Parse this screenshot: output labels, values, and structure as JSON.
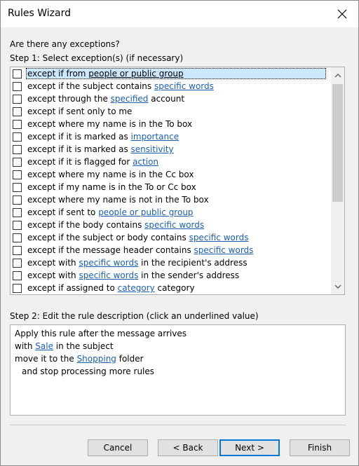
{
  "window": {
    "title": "Rules Wizard"
  },
  "question": "Are there any exceptions?",
  "step1_label": "Step 1: Select exception(s) (if necessary)",
  "exceptions": [
    {
      "parts": [
        {
          "t": "except if from "
        },
        {
          "t": "people or public group",
          "link": true,
          "dark": true
        }
      ],
      "selected": true
    },
    {
      "parts": [
        {
          "t": "except if the subject contains "
        },
        {
          "t": "specific words",
          "link": true
        }
      ]
    },
    {
      "parts": [
        {
          "t": "except through the "
        },
        {
          "t": "specified",
          "link": true
        },
        {
          "t": " account"
        }
      ]
    },
    {
      "parts": [
        {
          "t": "except if sent only to me"
        }
      ]
    },
    {
      "parts": [
        {
          "t": "except where my name is in the To box"
        }
      ]
    },
    {
      "parts": [
        {
          "t": "except if it is marked as "
        },
        {
          "t": "importance",
          "link": true
        }
      ]
    },
    {
      "parts": [
        {
          "t": "except if it is marked as "
        },
        {
          "t": "sensitivity",
          "link": true
        }
      ]
    },
    {
      "parts": [
        {
          "t": "except if it is flagged for "
        },
        {
          "t": "action",
          "link": true
        }
      ]
    },
    {
      "parts": [
        {
          "t": "except where my name is in the Cc box"
        }
      ]
    },
    {
      "parts": [
        {
          "t": "except if my name is in the To or Cc box"
        }
      ]
    },
    {
      "parts": [
        {
          "t": "except where my name is not in the To box"
        }
      ]
    },
    {
      "parts": [
        {
          "t": "except if sent to "
        },
        {
          "t": "people or public group",
          "link": true
        }
      ]
    },
    {
      "parts": [
        {
          "t": "except if the body contains "
        },
        {
          "t": "specific words",
          "link": true
        }
      ]
    },
    {
      "parts": [
        {
          "t": "except if the subject or body contains "
        },
        {
          "t": "specific words",
          "link": true
        }
      ]
    },
    {
      "parts": [
        {
          "t": "except if the message header contains "
        },
        {
          "t": "specific words",
          "link": true
        }
      ]
    },
    {
      "parts": [
        {
          "t": "except with "
        },
        {
          "t": "specific words",
          "link": true
        },
        {
          "t": " in the recipient's address"
        }
      ]
    },
    {
      "parts": [
        {
          "t": "except with "
        },
        {
          "t": "specific words",
          "link": true
        },
        {
          "t": " in the sender's address"
        }
      ]
    },
    {
      "parts": [
        {
          "t": "except if assigned to "
        },
        {
          "t": "category",
          "link": true
        },
        {
          "t": " category"
        }
      ]
    }
  ],
  "step2_label": "Step 2: Edit the rule description (click an underlined value)",
  "description": {
    "line1": "Apply this rule after the message arrives",
    "line2_pre": "with ",
    "line2_link": "Sale",
    "line2_post": " in the subject",
    "line3_pre": "move it to the ",
    "line3_link": "Shopping",
    "line3_post": " folder",
    "line4": "and stop processing more rules"
  },
  "buttons": {
    "cancel": "Cancel",
    "back": "< Back",
    "next": "Next >",
    "finish": "Finish"
  },
  "colors": {
    "link": "#1a5fb4",
    "selection": "#cce8ff",
    "default_button_border": "#0078d7"
  },
  "icons": {
    "close": "close-icon",
    "scroll_up": "chevron-up-icon",
    "scroll_down": "chevron-down-icon"
  }
}
